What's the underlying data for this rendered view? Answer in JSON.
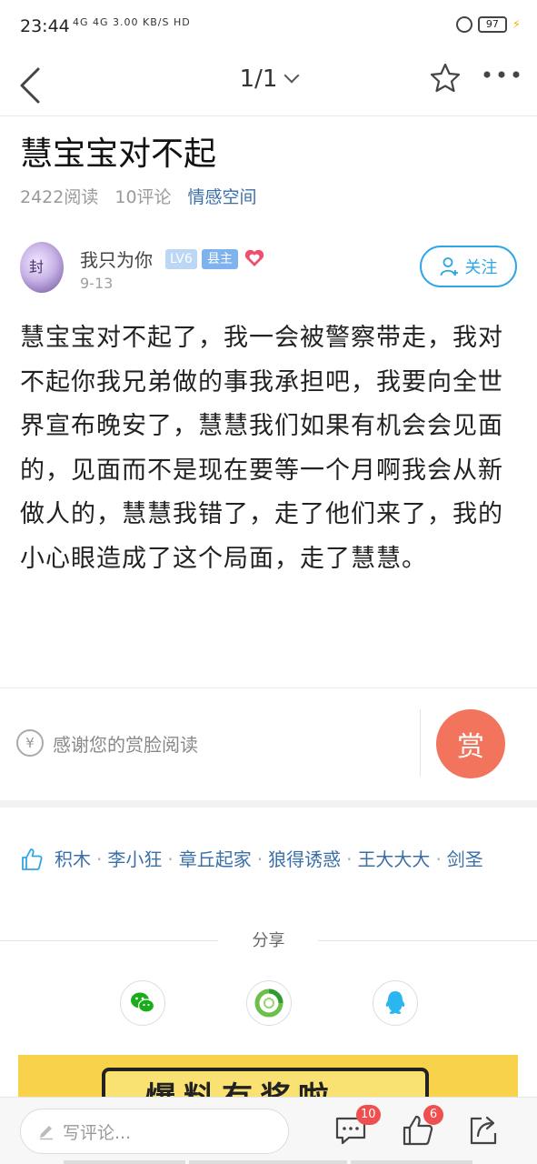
{
  "status_bar": {
    "time": "23:44",
    "signals": "4G 4G 3.00 KB/S HD",
    "battery": "97"
  },
  "nav": {
    "page_indicator": "1/1"
  },
  "post": {
    "title": "慧宝宝对不起",
    "reads": "2422阅读",
    "comments": "10评论",
    "category": "情感空间",
    "body": "慧宝宝对不起了，我一会被警察带走，我对不起你我兄弟做的事我承担吧，我要向全世界宣布晚安了，慧慧我们如果有机会会见面的，见面而不是现在要等一个月啊我会从新做人的，慧慧我错了，走了他们来了，我的小心眼造成了这个局面，走了慧慧。"
  },
  "author": {
    "name": "我只为你",
    "level": "LV6",
    "role": "县主",
    "date": "9-13",
    "follow_label": "关注"
  },
  "reward": {
    "text": "感谢您的赏脸阅读",
    "button_label": "赏",
    "currency_symbol": "¥"
  },
  "likers": {
    "names": [
      "积木",
      "李小狂",
      "章丘起家",
      "狼得诱惑",
      "王大大大",
      "剑圣"
    ]
  },
  "share": {
    "label": "分享",
    "targets": [
      "wechat-icon",
      "moments-icon",
      "qq-icon"
    ]
  },
  "banner": {
    "text": "爆料有奖啦"
  },
  "bottom_bar": {
    "comment_placeholder": "写评论...",
    "comment_count": "10",
    "like_count": "6"
  },
  "colors": {
    "accent": "#2fa6e6",
    "link": "#3b6fa8",
    "reward": "#f2745c",
    "badge": "#ef4f4f",
    "banner": "#f7d24a"
  }
}
